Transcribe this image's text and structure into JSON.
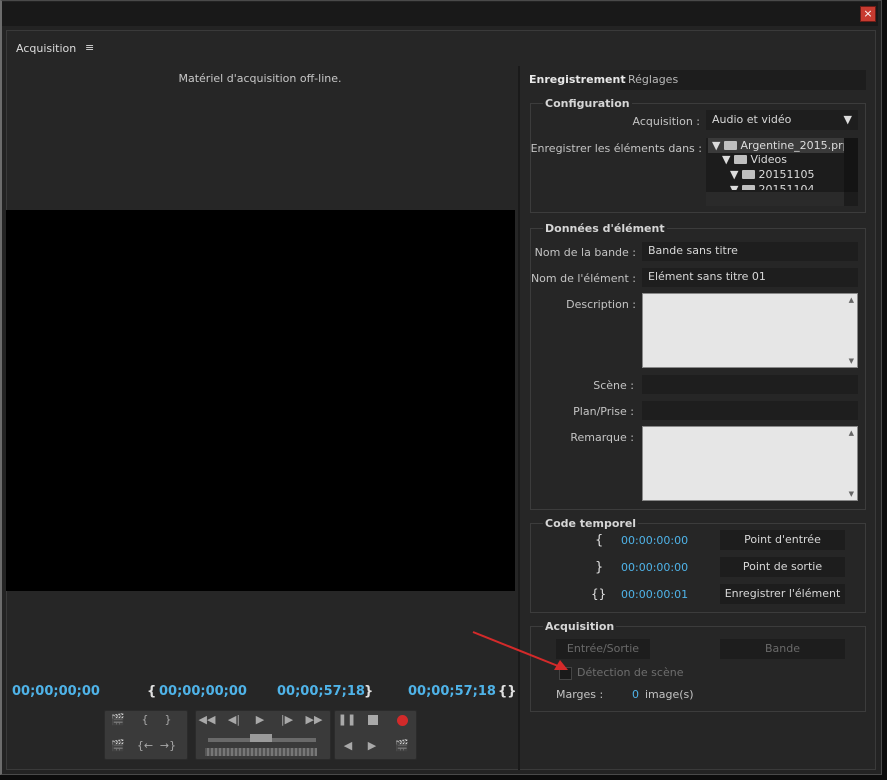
{
  "panel": {
    "title": "Acquisition",
    "menu_icon": "≡",
    "offline_text": "Matériel d'acquisition off-line."
  },
  "timecodes": {
    "current": "00;00;00;00",
    "in": "00;00;00;00",
    "out": "00;00;57;18",
    "duration": "00;00;57;18",
    "in_glyph": "{",
    "out_glyph": "}",
    "dur_glyph": "{}"
  },
  "tabs": {
    "active": "Enregistrement",
    "other": "Réglages"
  },
  "config": {
    "title": "Configuration",
    "acq_label": "Acquisition :",
    "acq_value": "Audio et vidéo",
    "save_label": "Enregistrer les éléments dans :",
    "tree": [
      "Argentine_2015.prp",
      "Videos",
      "20151105",
      "20151104"
    ]
  },
  "clipdata": {
    "title": "Données d'élément",
    "tape_label": "Nom de la bande :",
    "tape_value": "Bande sans titre",
    "clip_label": "Nom de l'élément :",
    "clip_value": "Elément sans titre 01",
    "desc_label": "Description :",
    "scene_label": "Scène :",
    "shot_label": "Plan/Prise :",
    "note_label": "Remarque :"
  },
  "timecode": {
    "title": "Code temporel",
    "in_value": "00:00:00:00",
    "out_value": "00:00:00:00",
    "dur_value": "00:00:00:01",
    "in_btn": "Point d'entrée",
    "out_btn": "Point de sortie",
    "rec_btn": "Enregistrer l'élément"
  },
  "capture": {
    "title": "Acquisition",
    "inout_btn": "Entrée/Sortie",
    "tape_btn": "Bande",
    "scene_detect": "Détection de scène",
    "margins_label": "Marges :",
    "margins_value": "0",
    "margins_unit": "image(s)"
  },
  "colors": {
    "timecode": "#4fb3e8",
    "record": "#d22a2a",
    "arrow": "#d42a2a"
  }
}
